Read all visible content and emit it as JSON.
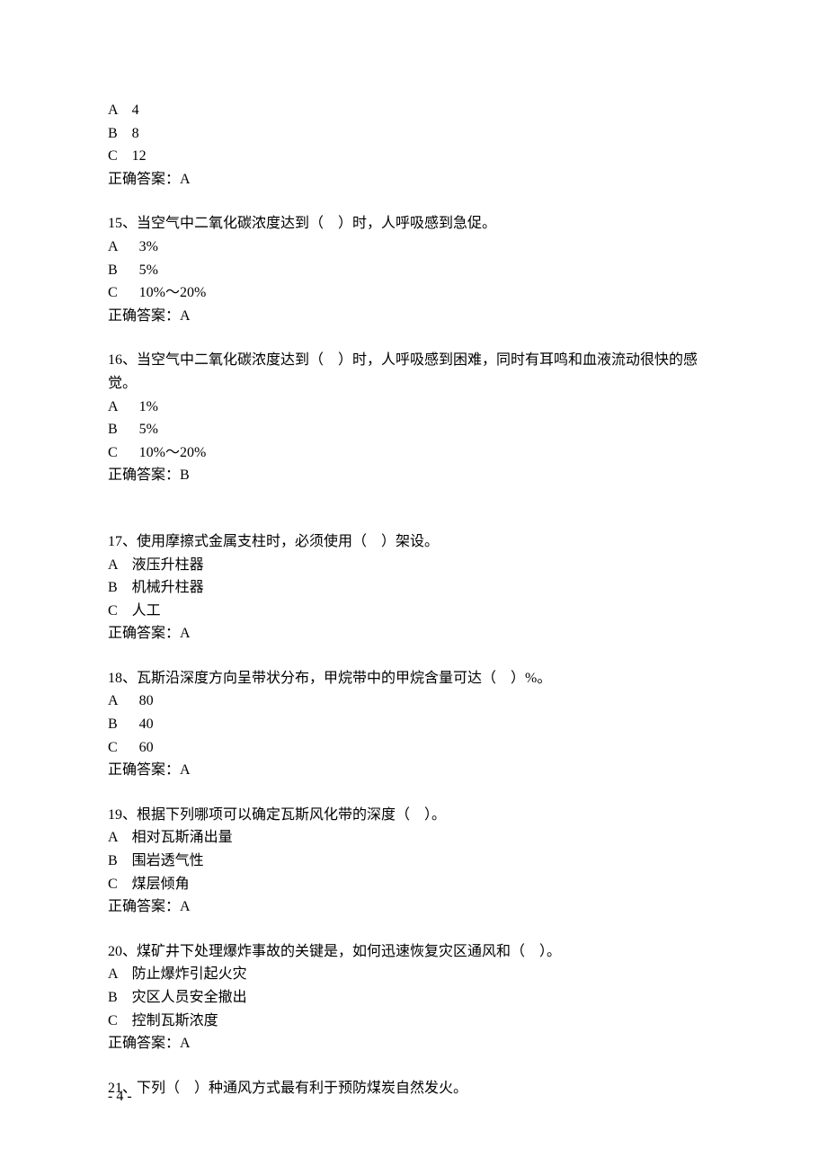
{
  "q14": {
    "optA": "A    4",
    "optB": "B    8",
    "optC": "C    12",
    "answer": "正确答案：A"
  },
  "q15": {
    "stem": "15、当空气中二氧化碳浓度达到（　）时，人呼吸感到急促。",
    "optA": "A      3%",
    "optB": "B      5%",
    "optC": "C      10%～20%",
    "answer": "正确答案：A"
  },
  "q16": {
    "stem": "16、当空气中二氧化碳浓度达到（　）时，人呼吸感到困难，同时有耳鸣和血液流动很快的感觉。",
    "optA": "A      1%",
    "optB": "B      5%",
    "optC": "C      10%～20%",
    "answer": "正确答案：B"
  },
  "q17": {
    "stem": "17、使用摩擦式金属支柱时，必须使用（　）架设。",
    "optA": "A    液压升柱器",
    "optB": "B    机械升柱器",
    "optC": "C    人工",
    "answer": "正确答案：A"
  },
  "q18": {
    "stem": "18、瓦斯沿深度方向呈带状分布，甲烷带中的甲烷含量可达（　）%。",
    "optA": "A      80",
    "optB": "B      40",
    "optC": "C      60",
    "answer": "正确答案：A"
  },
  "q19": {
    "stem": "19、根据下列哪项可以确定瓦斯风化带的深度（　）。",
    "optA": "A    相对瓦斯涌出量",
    "optB": "B    围岩透气性",
    "optC": "C    煤层倾角",
    "answer": "正确答案：A"
  },
  "q20": {
    "stem": "20、煤矿井下处理爆炸事故的关键是，如何迅速恢复灾区通风和（　）。",
    "optA": "A    防止爆炸引起火灾",
    "optB": "B    灾区人员安全撤出",
    "optC": "C    控制瓦斯浓度",
    "answer": "正确答案：A"
  },
  "q21": {
    "stem": "21、下列（　）种通风方式最有利于预防煤炭自然发火。"
  },
  "footer": "- 4 -"
}
